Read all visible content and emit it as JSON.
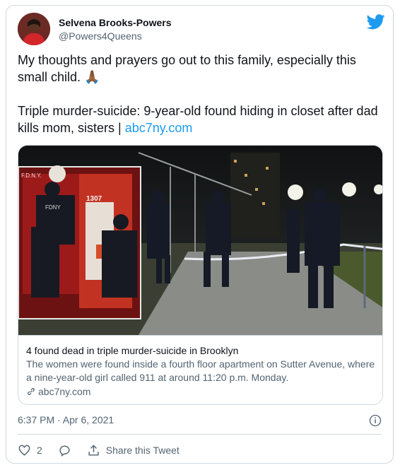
{
  "user": {
    "name": "Selvena Brooks-Powers",
    "handle": "@Powers4Queens"
  },
  "tweet": {
    "line1": "My thoughts and prayers go out to this family, especially this small child. 🙏🏾",
    "line2": "Triple murder-suicide: 9-year-old found hiding in closet after dad kills mom, sisters |",
    "link": "abc7ny.com"
  },
  "card": {
    "inset_label_top": "F.D.N.Y.",
    "inset_label_fdny": "FDNY",
    "inset_unit": "1307",
    "title": "4 found dead in triple murder-suicide in Brooklyn",
    "description": "The women were found inside a fourth floor apartment on Sutter Avenue, where a nine-year-old girl called 911 at around 11:20 p.m. Monday.",
    "domain": "abc7ny.com"
  },
  "timestamp": "6:37 PM · Apr 6, 2021",
  "actions": {
    "like_count": "2",
    "share_label": "Share this Tweet"
  },
  "colors": {
    "accent": "#1d9bf0",
    "secondary_text": "#536471",
    "border": "#cfd9de"
  },
  "icons": [
    "twitter-bird-icon",
    "info-icon",
    "heart-icon",
    "reply-icon",
    "share-icon",
    "link-icon"
  ]
}
